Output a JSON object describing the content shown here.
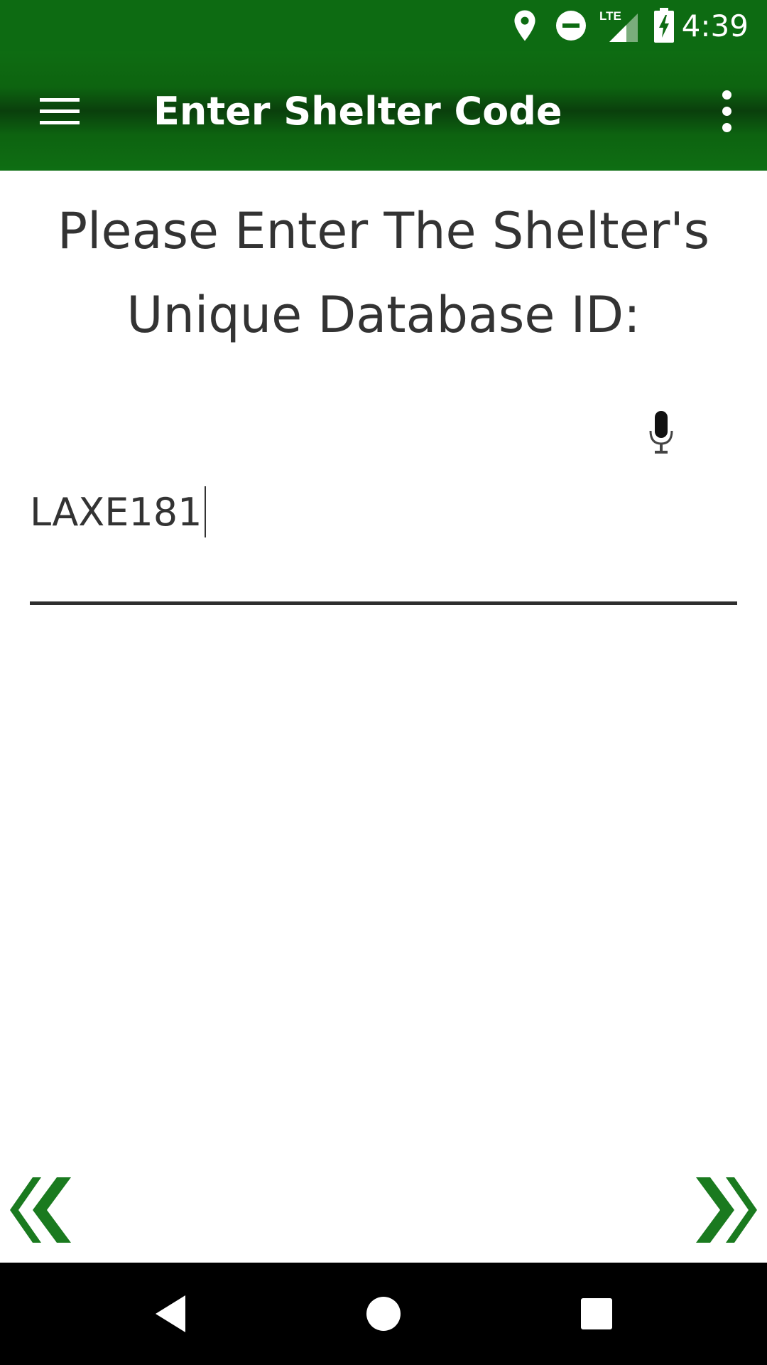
{
  "status_bar": {
    "time": "4:39",
    "network_label": "LTE",
    "icons": [
      "location-pin-icon",
      "do-not-disturb-icon",
      "lte-signal-icon",
      "battery-charging-icon"
    ]
  },
  "app_bar": {
    "title": "Enter Shelter Code",
    "background_color": "#0d6b12",
    "icons": [
      "hamburger-menu-icon",
      "overflow-menu-icon"
    ]
  },
  "main": {
    "prompt_line1": "Please Enter The Shelter's",
    "prompt_line2": "Unique Database ID:",
    "shelter_id_input": {
      "value": "LAXE181",
      "voice_input_icon": "microphone-icon"
    },
    "navigation": {
      "prev_icon": "double-chevron-left-icon",
      "next_icon": "double-chevron-right-icon",
      "arrow_color": "#1a7a1f"
    }
  },
  "system_nav": {
    "icons": [
      "back-icon",
      "home-icon",
      "recents-icon"
    ]
  }
}
